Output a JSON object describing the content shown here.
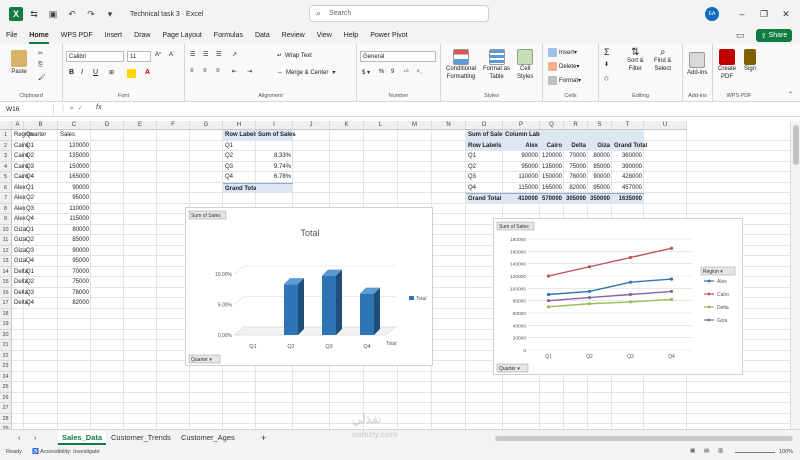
{
  "window": {
    "title": "Technical task 3  ·  Excel",
    "search_placeholder": "Search",
    "user_initials": "EA"
  },
  "menu": [
    "File",
    "Home",
    "WPS PDF",
    "Insert",
    "Draw",
    "Page Layout",
    "Formulas",
    "Data",
    "Review",
    "View",
    "Help",
    "Power Pivot"
  ],
  "share_label": "Share",
  "ribbon": {
    "paste": "Paste",
    "clipboard": "Clipboard",
    "font_name": "Calibri",
    "font_size": "11",
    "font": "Font",
    "wrap": "Wrap Text",
    "merge": "Merge & Center",
    "alignment": "Alignment",
    "number_format": "General",
    "number": "Number",
    "cond1": "Conditional",
    "cond2": "Formatting",
    "fmt1": "Format as",
    "fmt2": "Table",
    "cell1": "Cell",
    "cell2": "Styles",
    "styles": "Styles",
    "insert": "Insert",
    "delete": "Delete",
    "format": "Format",
    "cells": "Cells",
    "sort1": "Sort &",
    "sort2": "Filter",
    "find1": "Find &",
    "find2": "Select",
    "editing": "Editing",
    "addins1": "Add-ins",
    "addins": "Add-ins",
    "create1": "Create",
    "create2": "PDF",
    "sign": "Sign",
    "wpspdf": "WPS PDF"
  },
  "namebox": "W16",
  "fx": "fx",
  "columns": [
    "A",
    "B",
    "C",
    "D",
    "E",
    "F",
    "G",
    "H",
    "I",
    "J",
    "K",
    "L",
    "M",
    "N",
    "O",
    "P",
    "Q",
    "R",
    "S",
    "T",
    "U"
  ],
  "rows": [
    "1",
    "2",
    "3",
    "4",
    "5",
    "6",
    "7",
    "8",
    "9",
    "10",
    "11",
    "12",
    "13",
    "14",
    "15",
    "16",
    "17",
    "18",
    "19",
    "20",
    "21",
    "22",
    "23",
    "24",
    "25",
    "26",
    "27",
    "28",
    "29"
  ],
  "table": {
    "headers": [
      "Region",
      "Quarter",
      "Sales"
    ],
    "rows": [
      [
        "Cairo",
        "Q1",
        "120000"
      ],
      [
        "Cairo",
        "Q2",
        "135000"
      ],
      [
        "Cairo",
        "Q3",
        "150000"
      ],
      [
        "Cairo",
        "Q4",
        "165000"
      ],
      [
        "Alex",
        "Q1",
        "90000"
      ],
      [
        "Alex",
        "Q2",
        "95000"
      ],
      [
        "Alex",
        "Q3",
        "110000"
      ],
      [
        "Alex",
        "Q4",
        "115000"
      ],
      [
        "Giza",
        "Q1",
        "80000"
      ],
      [
        "Giza",
        "Q2",
        "85000"
      ],
      [
        "Giza",
        "Q3",
        "90000"
      ],
      [
        "Giza",
        "Q4",
        "95000"
      ],
      [
        "Delta",
        "Q1",
        "70000"
      ],
      [
        "Delta",
        "Q2",
        "75000"
      ],
      [
        "Delta",
        "Q3",
        "78000"
      ],
      [
        "Delta",
        "Q4",
        "82000"
      ]
    ]
  },
  "pivot1": {
    "h1": "Row Labels",
    "h2": "Sum of Sales",
    "rows": [
      [
        "Q1",
        ""
      ],
      [
        "Q2",
        "8.33%"
      ],
      [
        "Q3",
        "9.74%"
      ],
      [
        "Q4",
        "6.78%"
      ]
    ],
    "total": "Grand Total"
  },
  "pivot2": {
    "sum": "Sum of Sales",
    "col_labels": "Column Labels",
    "header": [
      "Row Labels",
      "Alex",
      "Cairo",
      "Delta",
      "Giza",
      "Grand Total"
    ],
    "rows": [
      [
        "Q1",
        "90000",
        "120000",
        "70000",
        "80000",
        "360000"
      ],
      [
        "Q2",
        "95000",
        "135000",
        "75000",
        "85000",
        "390000"
      ],
      [
        "Q3",
        "110000",
        "150000",
        "78000",
        "90000",
        "428000"
      ],
      [
        "Q4",
        "115000",
        "165000",
        "82000",
        "95000",
        "457000"
      ]
    ],
    "total": [
      "Grand Total",
      "410000",
      "570000",
      "305000",
      "350000",
      "1635000"
    ]
  },
  "chart_data": [
    {
      "type": "bar",
      "title": "Total",
      "field_button": "Sum of Sales",
      "axis_button": "Quarter",
      "categories": [
        "Q1",
        "Q2",
        "Q3",
        "Q4"
      ],
      "series": [
        {
          "name": "Total",
          "values": [
            0,
            8.33,
            9.74,
            6.78
          ]
        }
      ],
      "ylim": [
        0,
        10
      ],
      "yticks": [
        "0.00%",
        "5.00%",
        "10.00%"
      ],
      "x_label": "Total",
      "legend": "right",
      "color": "#2e75b6"
    },
    {
      "type": "line",
      "field_button": "Sum of Sales",
      "axis_button": "Quarter",
      "legend_title": "Region",
      "categories": [
        "Q1",
        "Q2",
        "Q3",
        "Q4"
      ],
      "ylim": [
        0,
        180000
      ],
      "yticks": [
        "0",
        "20000",
        "40000",
        "60000",
        "80000",
        "100000",
        "120000",
        "140000",
        "160000",
        "180000"
      ],
      "series": [
        {
          "name": "Alex",
          "values": [
            90000,
            95000,
            110000,
            115000
          ],
          "color": "#2e75b6"
        },
        {
          "name": "Cairo",
          "values": [
            120000,
            135000,
            150000,
            165000
          ],
          "color": "#c0504d"
        },
        {
          "name": "Delta",
          "values": [
            70000,
            75000,
            78000,
            82000
          ],
          "color": "#9bbb59"
        },
        {
          "name": "Giza",
          "values": [
            80000,
            85000,
            90000,
            95000
          ],
          "color": "#8064a2"
        }
      ],
      "legend": "right"
    }
  ],
  "sheets": [
    "Sales_Data",
    "Customer_Trends",
    "Customer_Ages"
  ],
  "status": {
    "ready": "Ready",
    "accessibility": "Accessibility: Investigate",
    "zoom": "100%"
  },
  "watermark": "نفذلي nafezly.com"
}
